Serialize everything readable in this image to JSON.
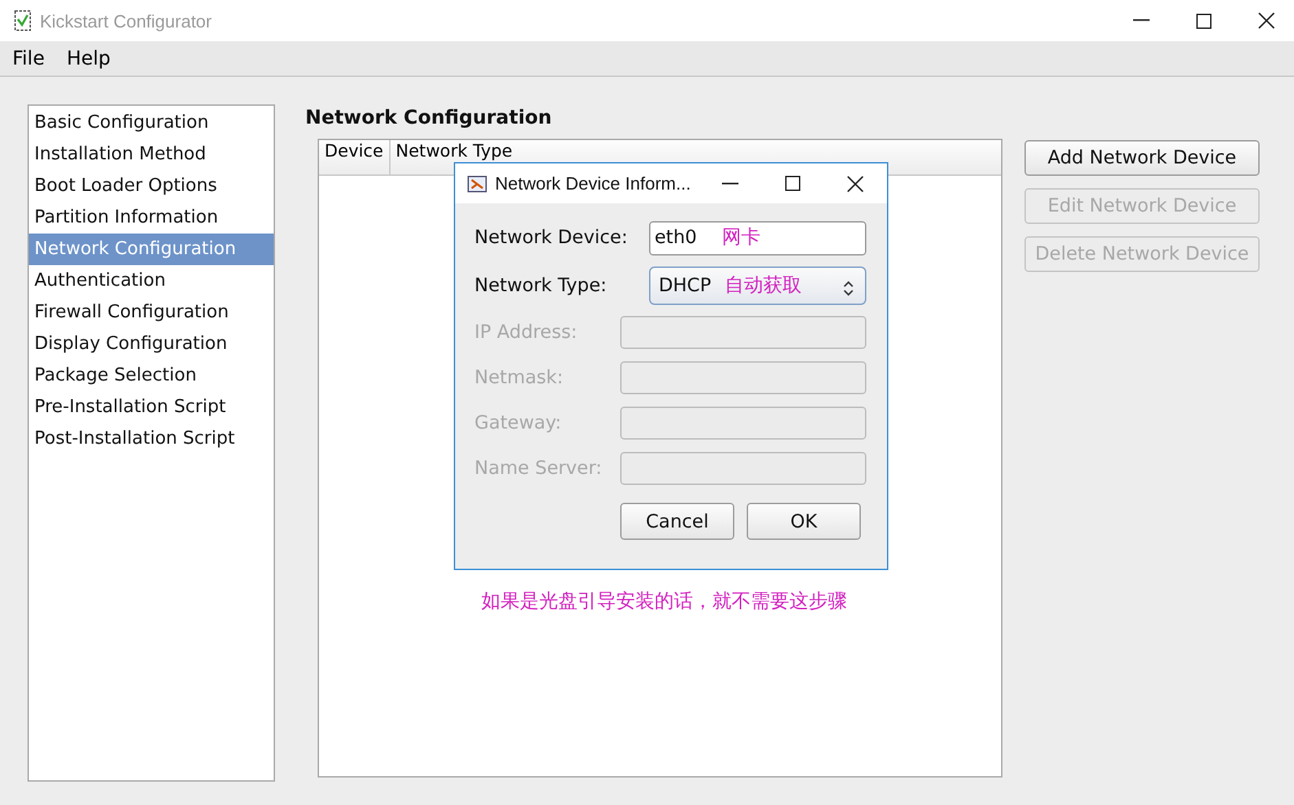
{
  "window": {
    "title": "Kickstart Configurator"
  },
  "menu": [
    "File",
    "Help"
  ],
  "sidebar": {
    "items": [
      {
        "label": "Basic Configuration",
        "selected": false
      },
      {
        "label": "Installation Method",
        "selected": false
      },
      {
        "label": "Boot Loader Options",
        "selected": false
      },
      {
        "label": "Partition Information",
        "selected": false
      },
      {
        "label": "Network Configuration",
        "selected": true
      },
      {
        "label": "Authentication",
        "selected": false
      },
      {
        "label": "Firewall Configuration",
        "selected": false
      },
      {
        "label": "Display Configuration",
        "selected": false
      },
      {
        "label": "Package Selection",
        "selected": false
      },
      {
        "label": "Pre-Installation Script",
        "selected": false
      },
      {
        "label": "Post-Installation Script",
        "selected": false
      }
    ]
  },
  "section_title": "Network Configuration",
  "table": {
    "columns": [
      "Device",
      "Network Type"
    ]
  },
  "actions": [
    {
      "label": "Add Network Device",
      "disabled": false
    },
    {
      "label": "Edit Network Device",
      "disabled": true
    },
    {
      "label": "Delete Network Device",
      "disabled": true
    }
  ],
  "dialog": {
    "title": "Network Device Inform...",
    "fields": [
      {
        "label": "Network Device:",
        "kind": "text",
        "value": "eth0",
        "annotation": "网卡",
        "disabled": false
      },
      {
        "label": "Network Type:",
        "kind": "select",
        "value": "DHCP",
        "annotation": "自动获取",
        "disabled": false
      },
      {
        "label": "IP Address:",
        "kind": "text",
        "disabled": true
      },
      {
        "label": "Netmask:",
        "kind": "text",
        "disabled": true
      },
      {
        "label": "Gateway:",
        "kind": "text",
        "disabled": true
      },
      {
        "label": "Name Server:",
        "kind": "text",
        "disabled": true
      }
    ],
    "buttons": [
      "Cancel",
      "OK"
    ]
  },
  "annotation": "如果是光盘引导安装的话，就不需要这步骤"
}
